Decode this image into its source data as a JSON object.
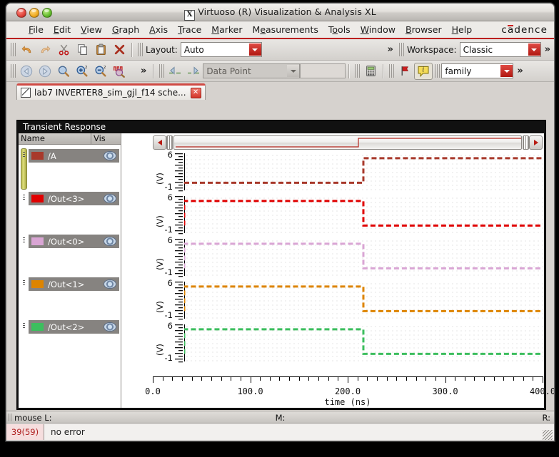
{
  "window": {
    "title": "Virtuoso (R) Visualization & Analysis XL",
    "app_icon": "x-window-icon",
    "brand": "cadence",
    "buttons": {
      "close": "close-window",
      "minimize": "minimize-window",
      "maximize": "maximize-window"
    }
  },
  "menubar": {
    "items": [
      {
        "label": "File",
        "mnemonic": "F"
      },
      {
        "label": "Edit",
        "mnemonic": "E"
      },
      {
        "label": "View",
        "mnemonic": "V"
      },
      {
        "label": "Graph",
        "mnemonic": "G"
      },
      {
        "label": "Axis",
        "mnemonic": "A"
      },
      {
        "label": "Trace",
        "mnemonic": "T"
      },
      {
        "label": "Marker",
        "mnemonic": "M"
      },
      {
        "label": "Measurements",
        "mnemonic": "e"
      },
      {
        "label": "Tools",
        "mnemonic": "o"
      },
      {
        "label": "Window",
        "mnemonic": "W"
      },
      {
        "label": "Browser",
        "mnemonic": "B"
      },
      {
        "label": "Help",
        "mnemonic": "H"
      }
    ]
  },
  "toolbar_row1": {
    "icons": [
      "undo-icon",
      "redo-icon",
      "cut-scissors-icon",
      "copy-icon",
      "paste-icon",
      "delete-x-icon"
    ],
    "layout_label": "Layout:",
    "layout_value": "Auto",
    "overflow": "»",
    "workspace_label": "Workspace:",
    "workspace_value": "Classic",
    "workspace_overflow": "»"
  },
  "toolbar_row2": {
    "icons": [
      "back-arrow-icon",
      "forward-arrow-icon",
      "zoom-fit-icon",
      "zoom-in-icon",
      "zoom-out-icon",
      "zoom-waveform-icon"
    ],
    "overflow": "»",
    "nav_icons": [
      "prev-point-icon",
      "next-point-icon"
    ],
    "datapoint_value": "Data Point",
    "blank_field_value": "",
    "calculator_icon": "calculator-icon",
    "flag_icon": "red-flag-icon",
    "info_icon": "info-balloon-icon",
    "family_value": "family",
    "family_overflow": "»"
  },
  "tab": {
    "icon": "schematic-icon",
    "label": "lab7 INVERTER8_sim_gjl_f14 sche...",
    "close": "✕"
  },
  "graph": {
    "title": "Transient Response",
    "columns": {
      "name": "Name",
      "vis": "Vis"
    },
    "signals": [
      {
        "name": "/A",
        "color": "#a8392b",
        "vis_icon": "eye-icon"
      },
      {
        "name": "/Out<3>",
        "color": "#e00000",
        "vis_icon": "eye-icon"
      },
      {
        "name": "/Out<0>",
        "color": "#d9a5d4",
        "vis_icon": "eye-icon"
      },
      {
        "name": "/Out<1>",
        "color": "#dd8400",
        "vis_icon": "eye-icon"
      },
      {
        "name": "/Out<2>",
        "color": "#3cbe5e",
        "vis_icon": "eye-icon"
      }
    ],
    "scrollbar": {
      "left_arrow": "◀",
      "right_arrow": "▶"
    }
  },
  "chart_data": {
    "type": "line",
    "title": "Transient Response",
    "xlabel": "time (ns)",
    "ylabel": "(V)",
    "xlim": [
      0,
      400
    ],
    "ylim": [
      -1,
      6
    ],
    "xticks": [
      0,
      100,
      200,
      300,
      400
    ],
    "xticklabels": [
      "0.0",
      "100.0",
      "200.0",
      "300.0",
      "400.0"
    ],
    "yticklabels": [
      "6",
      "-1"
    ],
    "grid": true,
    "legend": "left-panel",
    "linestyle": "dashed",
    "panels": [
      {
        "name": "/A",
        "color": "#a8392b",
        "ylabel": "(V)",
        "ymax_label": "6",
        "ymin_label": "-1",
        "x": [
          0,
          0,
          200,
          200,
          400
        ],
        "y": [
          0,
          0,
          0,
          5,
          5
        ],
        "description": "rises low-to-high at 200 ns"
      },
      {
        "name": "/Out<3>",
        "color": "#e00000",
        "ylabel": "(V)",
        "ymax_label": "6",
        "ymin_label": "-1",
        "x": [
          0,
          0,
          200,
          200,
          400
        ],
        "y": [
          0,
          5,
          5,
          0,
          0
        ],
        "description": "falls high-to-low at 200 ns"
      },
      {
        "name": "/Out<0>",
        "color": "#d9a5d4",
        "ylabel": "(V)",
        "ymax_label": "6",
        "ymin_label": "-1",
        "x": [
          0,
          0,
          200,
          200,
          400
        ],
        "y": [
          0,
          5,
          5,
          0,
          0
        ],
        "description": "falls high-to-low at 200 ns"
      },
      {
        "name": "/Out<1>",
        "color": "#dd8400",
        "ylabel": "(V)",
        "ymax_label": "6",
        "ymin_label": "-1",
        "x": [
          0,
          0,
          200,
          200,
          400
        ],
        "y": [
          0,
          5,
          5,
          0,
          0
        ],
        "description": "falls high-to-low at 200 ns"
      },
      {
        "name": "/Out<2>",
        "color": "#3cbe5e",
        "ylabel": "(V)",
        "ymax_label": "6",
        "ymin_label": "-1",
        "x": [
          0,
          0,
          200,
          200,
          400
        ],
        "y": [
          0,
          5,
          5,
          0,
          0
        ],
        "description": "falls high-to-low at 200 ns"
      }
    ]
  },
  "statusbar": {
    "mouse_label": "mouse L:",
    "middle_label": "M:",
    "right_label": "R:",
    "error_count": "39(59)",
    "error_message": "no error"
  },
  "colors": {
    "accent_red": "#bb1f1f",
    "panel_bg": "#d6d2ce",
    "graph_bg": "#ffffff",
    "graph_frame": "#111111"
  }
}
